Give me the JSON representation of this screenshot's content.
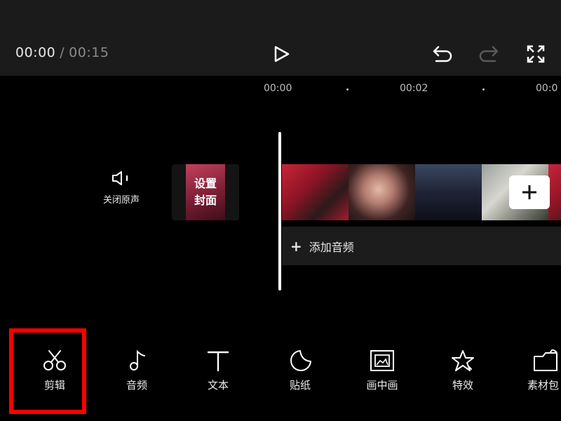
{
  "header": {
    "current_time": "00:00",
    "separator": "/",
    "total_time": "00:15"
  },
  "timeline": {
    "ruler_labels": [
      "00:00",
      "00:02",
      "00:0"
    ]
  },
  "track": {
    "mute_label": "关闭原声",
    "cover_label_line1": "设置",
    "cover_label_line2": "封面",
    "add_audio_label": "添加音频"
  },
  "toolbar": {
    "items": [
      {
        "label": "剪辑",
        "icon": "scissors-icon"
      },
      {
        "label": "音频",
        "icon": "music-note-icon"
      },
      {
        "label": "文本",
        "icon": "text-icon"
      },
      {
        "label": "贴纸",
        "icon": "sticker-icon"
      },
      {
        "label": "画中画",
        "icon": "picture-in-picture-icon"
      },
      {
        "label": "特效",
        "icon": "effects-star-icon"
      },
      {
        "label": "素材包",
        "icon": "material-pack-icon"
      }
    ]
  },
  "colors": {
    "highlight": "#ff0000",
    "topbar": "#1b1b1b",
    "background": "#000000"
  }
}
